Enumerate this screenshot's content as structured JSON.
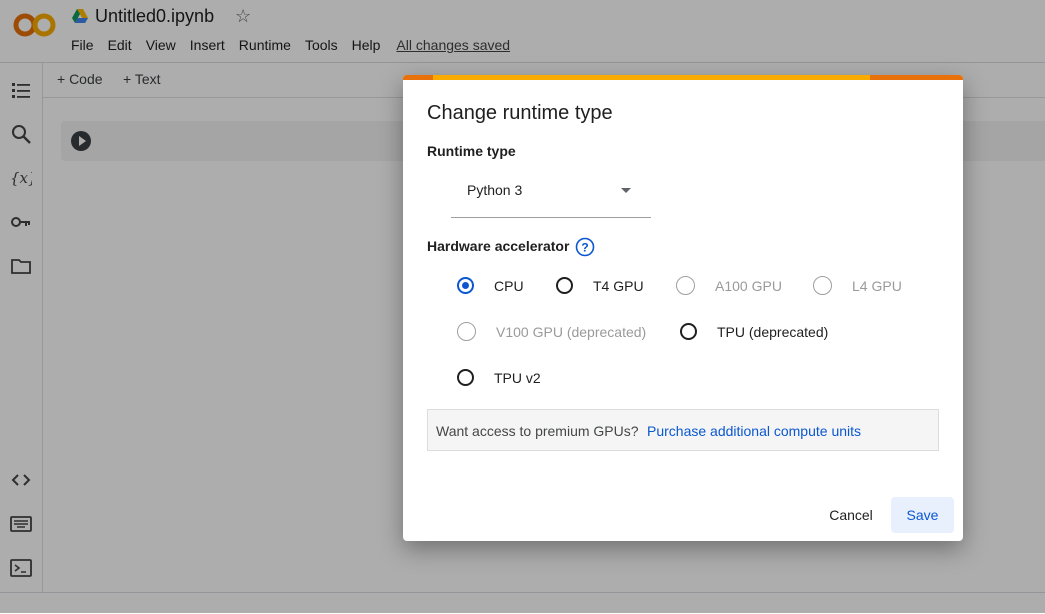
{
  "app": {
    "filename": "Untitled0.ipynb",
    "menu": [
      "File",
      "Edit",
      "View",
      "Insert",
      "Runtime",
      "Tools",
      "Help"
    ],
    "save_status": "All changes saved",
    "toolbar": {
      "code_label": "+ Code",
      "text_label": "+ Text"
    }
  },
  "dialog": {
    "title": "Change runtime type",
    "runtime_type_label": "Runtime type",
    "runtime_type_value": "Python 3",
    "hardware_label": "Hardware accelerator",
    "options": [
      {
        "label": "CPU",
        "checked": true,
        "disabled": false
      },
      {
        "label": "T4 GPU",
        "checked": false,
        "disabled": false
      },
      {
        "label": "A100 GPU",
        "checked": false,
        "disabled": true
      },
      {
        "label": "L4 GPU",
        "checked": false,
        "disabled": true
      },
      {
        "label": "V100 GPU (deprecated)",
        "checked": false,
        "disabled": true
      },
      {
        "label": "TPU (deprecated)",
        "checked": false,
        "disabled": false
      },
      {
        "label": "TPU v2",
        "checked": false,
        "disabled": false
      }
    ],
    "banner_text": "Want access to premium GPUs?",
    "banner_link": "Purchase additional compute units",
    "cancel_label": "Cancel",
    "save_label": "Save"
  },
  "colors": {
    "accent": "#0b57d0",
    "progress": "#f9ab00",
    "progress_dark": "#e8710a"
  }
}
